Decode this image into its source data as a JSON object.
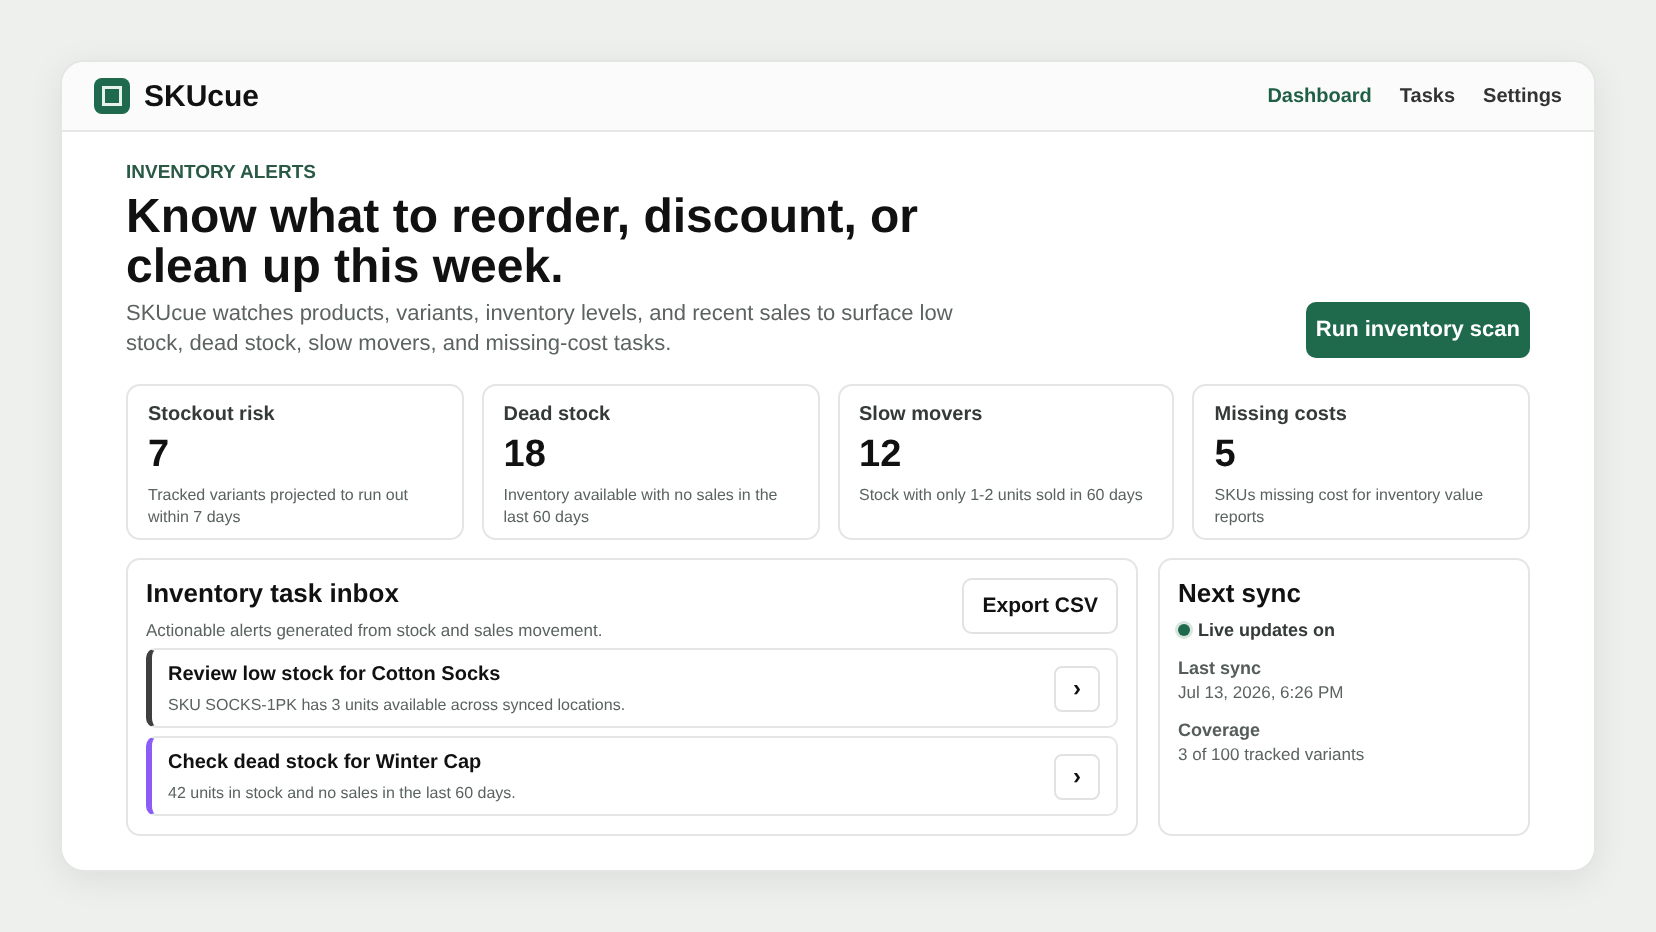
{
  "brand": {
    "name": "SKUcue"
  },
  "nav": [
    {
      "label": "Dashboard",
      "selected": true
    },
    {
      "label": "Tasks",
      "selected": false
    },
    {
      "label": "Settings",
      "selected": false
    }
  ],
  "hero": {
    "eyebrow": "INVENTORY ALERTS",
    "title": "Know what to reorder, discount, or clean up this week.",
    "description": "SKUcue watches products, variants, inventory levels, and recent sales to surface low stock, dead stock, slow movers, and missing-cost tasks.",
    "action": "Run inventory scan"
  },
  "metrics": [
    {
      "label": "Stockout risk",
      "value": "7",
      "note": "Tracked variants projected to run out within 7 days"
    },
    {
      "label": "Dead stock",
      "value": "18",
      "note": "Inventory available with no sales in the last 60 days"
    },
    {
      "label": "Slow movers",
      "value": "12",
      "note": "Stock with only 1-2 units sold in 60 days"
    },
    {
      "label": "Missing costs",
      "value": "5",
      "note": "SKUs missing cost for inventory value reports"
    }
  ],
  "inbox": {
    "title": "Inventory task inbox",
    "subtitle": "Actionable alerts generated from stock and sales movement.",
    "export": "Export CSV",
    "tasks": [
      {
        "title": "Review low stock for Cotton Socks",
        "detail": "SKU SOCKS-1PK has 3 units available across synced locations.",
        "color": "#3f3f3f",
        "open": "›"
      },
      {
        "title": "Check dead stock for Winter Cap",
        "detail": "42 units in stock and no sales in the last 60 days.",
        "color": "#8b5cf6",
        "open": "›"
      }
    ]
  },
  "sync": {
    "title": "Next sync",
    "live": {
      "label": "Live updates on",
      "on": true
    },
    "fields": [
      {
        "label": "Last sync",
        "value": "Jul 13, 2026, 6:26 PM"
      },
      {
        "label": "Coverage",
        "value": "3 of 100 tracked variants"
      }
    ]
  }
}
